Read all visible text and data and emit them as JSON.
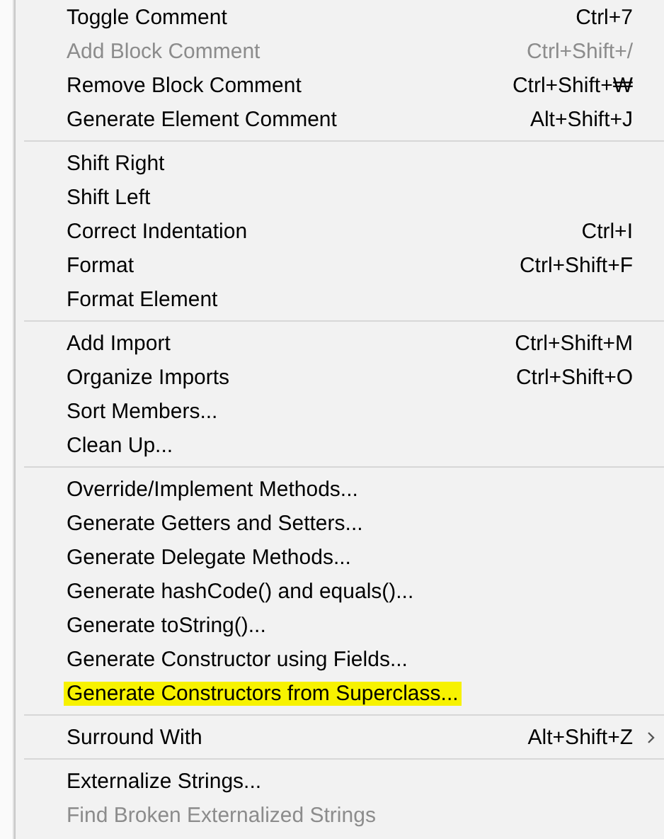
{
  "menu": {
    "sections": [
      {
        "items": [
          {
            "label": "Toggle Comment",
            "shortcut": "Ctrl+7",
            "disabled": false,
            "highlighted": false,
            "has_submenu": false
          },
          {
            "label": "Add Block Comment",
            "shortcut": "Ctrl+Shift+/",
            "disabled": true,
            "highlighted": false,
            "has_submenu": false
          },
          {
            "label": "Remove Block Comment",
            "shortcut": "Ctrl+Shift+₩",
            "disabled": false,
            "highlighted": false,
            "has_submenu": false
          },
          {
            "label": "Generate Element Comment",
            "shortcut": "Alt+Shift+J",
            "disabled": false,
            "highlighted": false,
            "has_submenu": false
          }
        ]
      },
      {
        "items": [
          {
            "label": "Shift Right",
            "disabled": false,
            "highlighted": false,
            "has_submenu": false
          },
          {
            "label": "Shift Left",
            "disabled": false,
            "highlighted": false,
            "has_submenu": false
          },
          {
            "label": "Correct Indentation",
            "shortcut": "Ctrl+I",
            "disabled": false,
            "highlighted": false,
            "has_submenu": false
          },
          {
            "label": "Format",
            "shortcut": "Ctrl+Shift+F",
            "disabled": false,
            "highlighted": false,
            "has_submenu": false
          },
          {
            "label": "Format Element",
            "disabled": false,
            "highlighted": false,
            "has_submenu": false
          }
        ]
      },
      {
        "items": [
          {
            "label": "Add Import",
            "shortcut": "Ctrl+Shift+M",
            "disabled": false,
            "highlighted": false,
            "has_submenu": false
          },
          {
            "label": "Organize Imports",
            "shortcut": "Ctrl+Shift+O",
            "disabled": false,
            "highlighted": false,
            "has_submenu": false
          },
          {
            "label": "Sort Members...",
            "disabled": false,
            "highlighted": false,
            "has_submenu": false
          },
          {
            "label": "Clean Up...",
            "disabled": false,
            "highlighted": false,
            "has_submenu": false
          }
        ]
      },
      {
        "items": [
          {
            "label": "Override/Implement Methods...",
            "disabled": false,
            "highlighted": false,
            "has_submenu": false
          },
          {
            "label": "Generate Getters and Setters...",
            "disabled": false,
            "highlighted": false,
            "has_submenu": false
          },
          {
            "label": "Generate Delegate Methods...",
            "disabled": false,
            "highlighted": false,
            "has_submenu": false
          },
          {
            "label": "Generate hashCode() and equals()...",
            "disabled": false,
            "highlighted": false,
            "has_submenu": false
          },
          {
            "label": "Generate toString()...",
            "disabled": false,
            "highlighted": false,
            "has_submenu": false
          },
          {
            "label": "Generate Constructor using Fields...",
            "disabled": false,
            "highlighted": false,
            "has_submenu": false
          },
          {
            "label": "Generate Constructors from Superclass...",
            "disabled": false,
            "highlighted": true,
            "has_submenu": false
          }
        ]
      },
      {
        "items": [
          {
            "label": "Surround With",
            "shortcut": "Alt+Shift+Z",
            "disabled": false,
            "highlighted": false,
            "has_submenu": true
          }
        ]
      },
      {
        "items": [
          {
            "label": "Externalize Strings...",
            "disabled": false,
            "highlighted": false,
            "has_submenu": false
          },
          {
            "label": "Find Broken Externalized Strings",
            "disabled": true,
            "highlighted": false,
            "has_submenu": false
          }
        ]
      }
    ]
  }
}
